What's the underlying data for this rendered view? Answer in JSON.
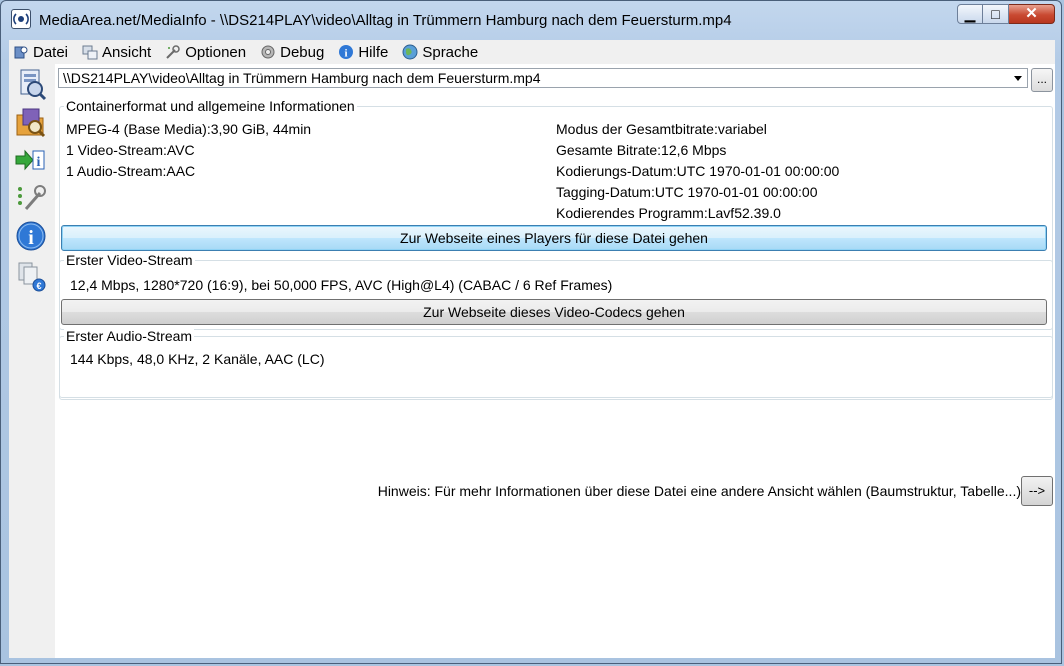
{
  "window": {
    "title": "MediaArea.net/MediaInfo - \\\\DS214PLAY\\video\\Alltag in Trümmern  Hamburg nach dem Feuersturm.mp4",
    "minimize_glyph": "▁",
    "maximize_glyph": "□",
    "close_glyph": "✕"
  },
  "menu": {
    "items": [
      {
        "label": "Datei",
        "icon": "file-icon"
      },
      {
        "label": "Ansicht",
        "icon": "view-icon"
      },
      {
        "label": "Optionen",
        "icon": "options-icon"
      },
      {
        "label": "Debug",
        "icon": "debug-icon"
      },
      {
        "label": "Hilfe",
        "icon": "help-icon"
      },
      {
        "label": "Sprache",
        "icon": "globe-icon"
      }
    ]
  },
  "toolbar": {
    "icons": [
      "open-file-icon",
      "open-folder-icon",
      "export-icon",
      "preferences-icon",
      "info-icon",
      "donate-icon"
    ]
  },
  "file": {
    "path": "\\\\DS214PLAY\\video\\Alltag in Trümmern  Hamburg nach dem Feuersturm.mp4",
    "browse_label": "..."
  },
  "general": {
    "title": "Containerformat und allgemeine Informationen",
    "left": [
      "MPEG-4 (Base Media):3,90 GiB, 44min",
      "1 Video-Stream:AVC",
      "1 Audio-Stream:AAC"
    ],
    "right": [
      "Modus der Gesamtbitrate:variabel",
      "Gesamte Bitrate:12,6 Mbps",
      "Kodierungs-Datum:UTC 1970-01-01 00:00:00",
      "Tagging-Datum:UTC 1970-01-01 00:00:00",
      "Kodierendes Programm:Lavf52.39.0"
    ],
    "player_button": "Zur Webseite eines Players für diese Datei gehen"
  },
  "video": {
    "title": "Erster Video-Stream",
    "info": "12,4 Mbps, 1280*720 (16:9), bei 50,000 FPS, AVC (High@L4) (CABAC / 6 Ref Frames)",
    "codec_button": "Zur Webseite dieses Video-Codecs gehen"
  },
  "audio": {
    "title": "Erster Audio-Stream",
    "info": "144 Kbps, 48,0 KHz, 2 Kanäle, AAC (LC)"
  },
  "footer": {
    "hint": "Hinweis: Für mehr Informationen über diese Datei eine andere Ansicht wählen (Baumstruktur, Tabelle...)",
    "next_label": "-->"
  }
}
